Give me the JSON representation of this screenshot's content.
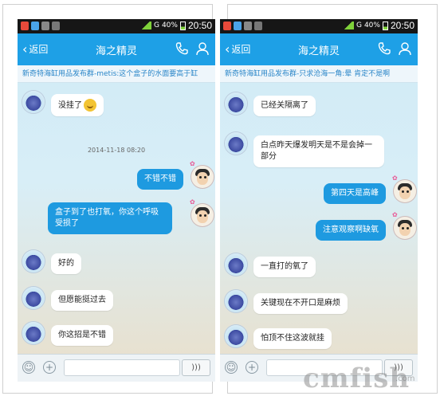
{
  "status_bar": {
    "time": "20:50",
    "battery": "40%",
    "network": "G"
  },
  "title_bar": {
    "back_label": "返回",
    "title": "海之精灵"
  },
  "left_panel": {
    "group_banner": "新奇特海缸用品发布群-metis:这个盒子的水面要高于缸",
    "timestamp": "2014-11-18 08:20",
    "messages": [
      {
        "side": "left",
        "text": "没挂了"
      },
      {
        "side": "right",
        "text": "不错不错"
      },
      {
        "side": "right",
        "text": "盒子到了也打氧，你这个呼吸受损了"
      },
      {
        "side": "left",
        "text": "好的"
      },
      {
        "side": "left",
        "text": "但愿能挺过去"
      },
      {
        "side": "left",
        "text": "你这招是不错"
      }
    ]
  },
  "right_panel": {
    "group_banner": "新奇特海缸用品发布群-只求沧海一角:晕  肯定不是啊",
    "messages": [
      {
        "side": "left",
        "text": "已经关隔离了"
      },
      {
        "side": "left",
        "text": "白点昨天爆发明天是不是会掉一部分"
      },
      {
        "side": "right",
        "text": "第四天是高峰"
      },
      {
        "side": "right",
        "text": "注意观察啊缺氧"
      },
      {
        "side": "left",
        "text": "一直打的氧了"
      },
      {
        "side": "left",
        "text": "关键现在不开口是麻烦"
      },
      {
        "side": "left",
        "text": "怕顶不住这波就挂"
      }
    ]
  },
  "input_bar": {
    "voice_label": ")))"
  },
  "watermark": {
    "text": "cmfish",
    "sub": ".com"
  },
  "colors": {
    "accent": "#1ea0e6",
    "bubble_self": "#1e9ae0",
    "bubble_other": "#ffffff"
  },
  "icons": [
    "back-chevron-icon",
    "phone-icon",
    "person-icon",
    "emoji-icon",
    "plus-icon",
    "voice-icon"
  ]
}
